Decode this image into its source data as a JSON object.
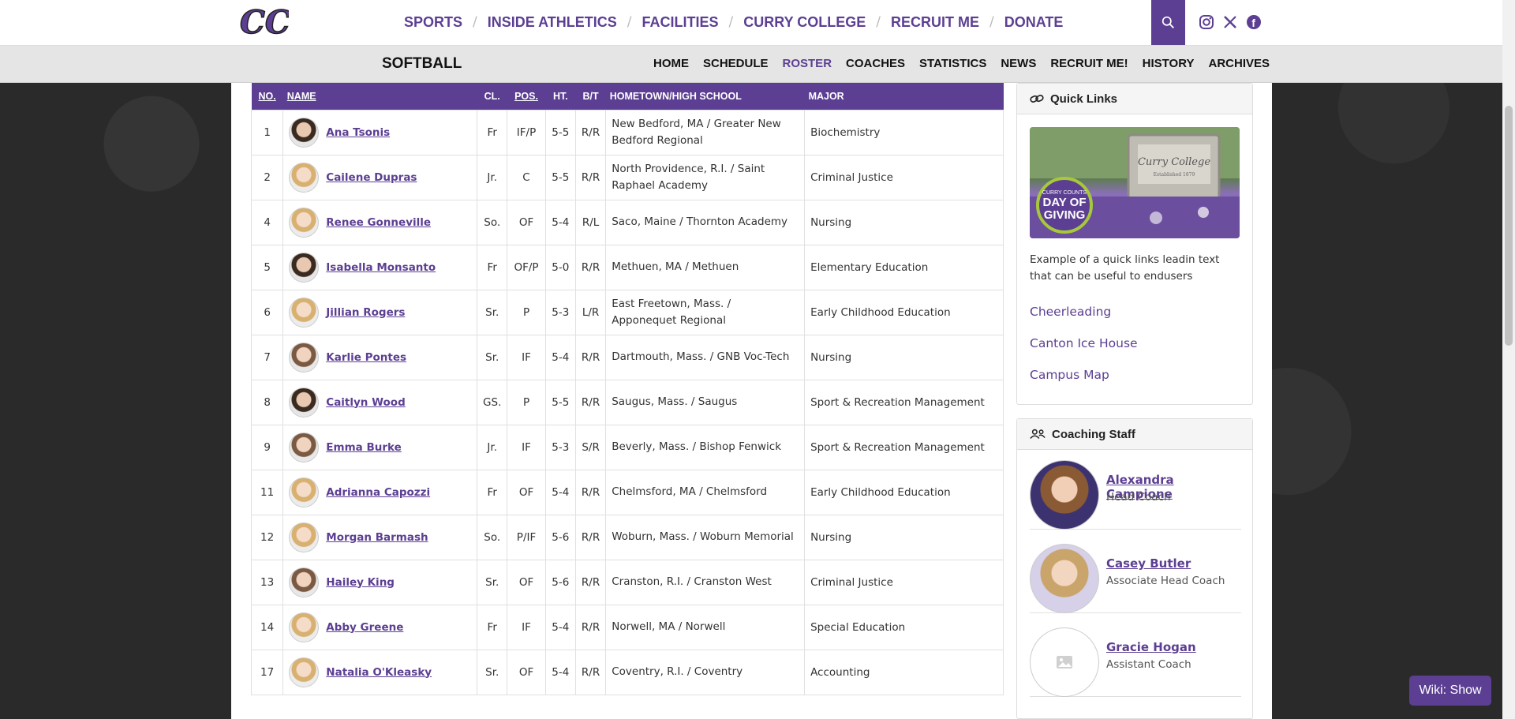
{
  "header": {
    "nav": [
      "SPORTS",
      "INSIDE ATHLETICS",
      "FACILITIES",
      "CURRY COLLEGE",
      "RECRUIT ME",
      "DONATE"
    ]
  },
  "subheader": {
    "sport": "SOFTBALL",
    "nav": [
      "HOME",
      "SCHEDULE",
      "ROSTER",
      "COACHES",
      "STATISTICS",
      "NEWS",
      "RECRUIT ME!",
      "HISTORY",
      "ARCHIVES"
    ],
    "active": "ROSTER"
  },
  "roster": {
    "columns": [
      "NO.",
      "NAME",
      "CL.",
      "POS.",
      "HT.",
      "B/T",
      "HOMETOWN/HIGH SCHOOL",
      "MAJOR"
    ],
    "rows": [
      {
        "no": "1",
        "name": "Ana Tsonis",
        "cl": "Fr",
        "pos": "IF/P",
        "ht": "5-5",
        "bt": "R/R",
        "hometown": "New Bedford, MA / Greater New Bedford Regional",
        "major": "Biochemistry",
        "hair": "dark"
      },
      {
        "no": "2",
        "name": "Cailene Dupras",
        "cl": "Jr.",
        "pos": "C",
        "ht": "5-5",
        "bt": "R/R",
        "hometown": "North Providence, R.I. / Saint Raphael Academy",
        "major": "Criminal Justice",
        "hair": "blonde"
      },
      {
        "no": "4",
        "name": "Renee Gonneville",
        "cl": "So.",
        "pos": "OF",
        "ht": "5-4",
        "bt": "R/L",
        "hometown": "Saco, Maine / Thornton Academy",
        "major": "Nursing",
        "hair": "blonde"
      },
      {
        "no": "5",
        "name": "Isabella Monsanto",
        "cl": "Fr",
        "pos": "OF/P",
        "ht": "5-0",
        "bt": "R/R",
        "hometown": "Methuen, MA / Methuen",
        "major": "Elementary Education",
        "hair": "dark"
      },
      {
        "no": "6",
        "name": "Jillian Rogers",
        "cl": "Sr.",
        "pos": "P",
        "ht": "5-3",
        "bt": "L/R",
        "hometown": "East Freetown, Mass. / Apponequet Regional",
        "major": "Early Childhood Education",
        "hair": "blonde"
      },
      {
        "no": "7",
        "name": "Karlie Pontes",
        "cl": "Sr.",
        "pos": "IF",
        "ht": "5-4",
        "bt": "R/R",
        "hometown": "Dartmouth, Mass. / GNB Voc-Tech",
        "major": "Nursing",
        "hair": "brown"
      },
      {
        "no": "8",
        "name": "Caitlyn Wood",
        "cl": "GS.",
        "pos": "P",
        "ht": "5-5",
        "bt": "R/R",
        "hometown": "Saugus, Mass. / Saugus",
        "major": "Sport & Recreation Management",
        "hair": "dark"
      },
      {
        "no": "9",
        "name": "Emma Burke",
        "cl": "Jr.",
        "pos": "IF",
        "ht": "5-3",
        "bt": "S/R",
        "hometown": "Beverly, Mass. / Bishop Fenwick",
        "major": "Sport & Recreation Management",
        "hair": "brown"
      },
      {
        "no": "11",
        "name": "Adrianna Capozzi",
        "cl": "Fr",
        "pos": "OF",
        "ht": "5-4",
        "bt": "R/R",
        "hometown": "Chelmsford, MA / Chelmsford",
        "major": "Early Childhood Education",
        "hair": "blonde"
      },
      {
        "no": "12",
        "name": "Morgan Barmash",
        "cl": "So.",
        "pos": "P/IF",
        "ht": "5-6",
        "bt": "R/R",
        "hometown": "Woburn, Mass. / Woburn Memorial",
        "major": "Nursing",
        "hair": "blonde"
      },
      {
        "no": "13",
        "name": "Hailey King",
        "cl": "Sr.",
        "pos": "OF",
        "ht": "5-6",
        "bt": "R/R",
        "hometown": "Cranston, R.I. / Cranston West",
        "major": "Criminal Justice",
        "hair": "brown"
      },
      {
        "no": "14",
        "name": "Abby Greene",
        "cl": "Fr",
        "pos": "IF",
        "ht": "5-4",
        "bt": "R/R",
        "hometown": "Norwell, MA / Norwell",
        "major": "Special Education",
        "hair": "blonde"
      },
      {
        "no": "17",
        "name": "Natalia O'Kleasky",
        "cl": "Sr.",
        "pos": "OF",
        "ht": "5-4",
        "bt": "R/R",
        "hometown": "Coventry, R.I. / Coventry",
        "major": "Accounting",
        "hair": "blonde"
      }
    ]
  },
  "quick_links": {
    "title": "Quick Links",
    "image_text": [
      "CURRY COUNTS",
      "DAY OF",
      "GIVING",
      "Curry College",
      "Established 1879"
    ],
    "intro": "Example of a quick links leadin text that can be useful to endusers",
    "links": [
      "Cheerleading",
      "Canton Ice House",
      "Campus Map"
    ]
  },
  "coaching_staff": {
    "title": "Coaching Staff",
    "coaches": [
      {
        "name": "Alexandra Campione",
        "role": "Head Coach"
      },
      {
        "name": "Casey Butler",
        "role": "Associate Head Coach"
      },
      {
        "name": "Gracie Hogan",
        "role": "Assistant Coach"
      }
    ]
  },
  "wiki_button": "Wiki: Show",
  "colors": {
    "accent": "#5c3f92",
    "header_gray": "#e5e5e5"
  }
}
